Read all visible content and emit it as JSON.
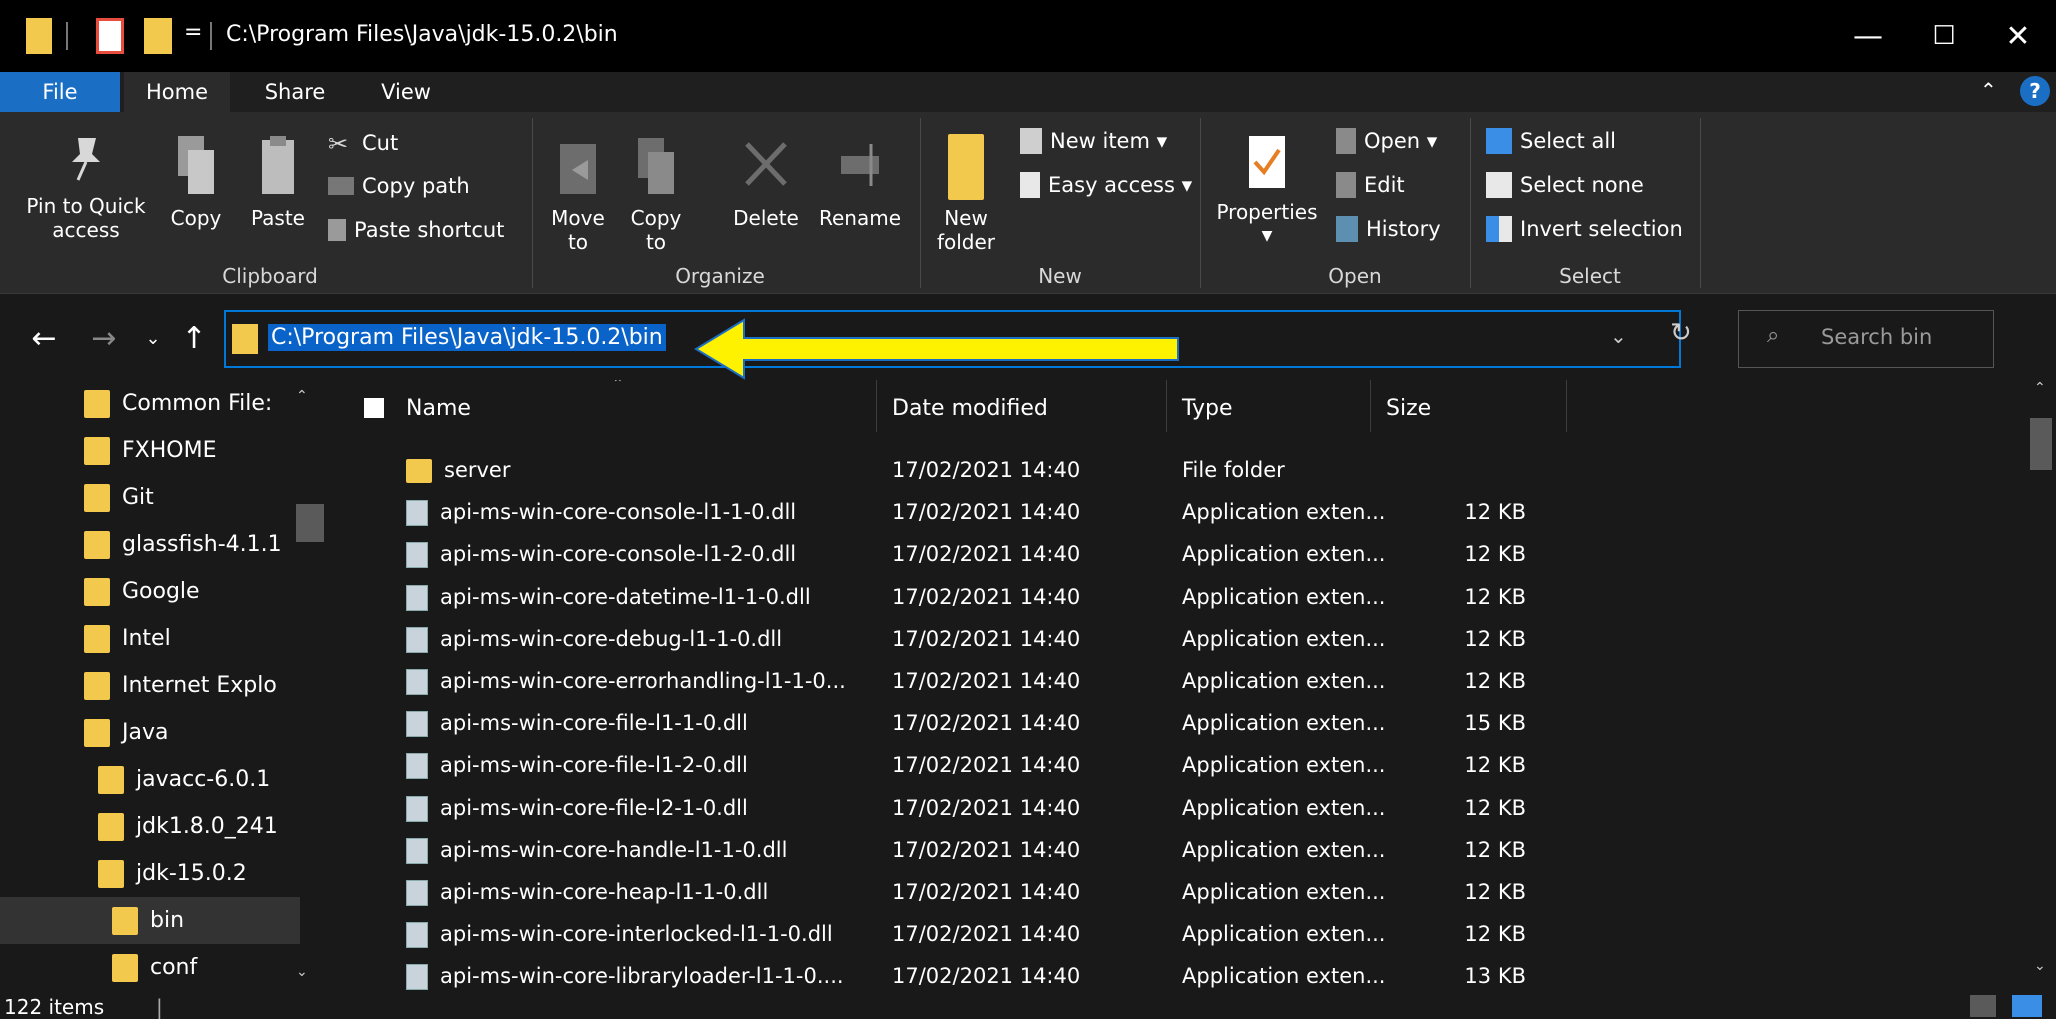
{
  "window": {
    "title": "C:\\Program Files\\Java\\jdk-15.0.2\\bin",
    "qat_dropdown": "=",
    "minimize": "—",
    "maximize": "☐",
    "close": "✕"
  },
  "tabs": [
    "File",
    "Home",
    "Share",
    "View"
  ],
  "ribbon": {
    "clipboard": {
      "pin": "Pin to Quick access",
      "copy": "Copy",
      "paste": "Paste",
      "cut": "Cut",
      "copy_path": "Copy path",
      "paste_shortcut": "Paste shortcut",
      "label": "Clipboard"
    },
    "organize": {
      "move_to": "Move to",
      "copy_to": "Copy to",
      "delete": "Delete",
      "rename": "Rename",
      "label": "Organize"
    },
    "new": {
      "new_folder": "New folder",
      "new_item": "New item ▾",
      "easy_access": "Easy access ▾",
      "label": "New"
    },
    "open": {
      "properties": "Properties",
      "open": "Open ▾",
      "edit": "Edit",
      "history": "History",
      "label": "Open"
    },
    "select": {
      "select_all": "Select all",
      "select_none": "Select none",
      "invert": "Invert selection",
      "label": "Select"
    }
  },
  "address": {
    "path": "C:\\Program Files\\Java\\jdk-15.0.2\\bin",
    "search_placeholder": "Search bin"
  },
  "nav_pane": [
    {
      "label": "Common File:",
      "indent": 1
    },
    {
      "label": "FXHOME",
      "indent": 1
    },
    {
      "label": "Git",
      "indent": 1
    },
    {
      "label": "glassfish-4.1.1",
      "indent": 1
    },
    {
      "label": "Google",
      "indent": 1
    },
    {
      "label": "Intel",
      "indent": 1
    },
    {
      "label": "Internet Explo",
      "indent": 1
    },
    {
      "label": "Java",
      "indent": 1
    },
    {
      "label": "javacc-6.0.1",
      "indent": 2
    },
    {
      "label": "jdk1.8.0_241",
      "indent": 2
    },
    {
      "label": "jdk-15.0.2",
      "indent": 2
    },
    {
      "label": "bin",
      "indent": 3,
      "selected": true
    },
    {
      "label": "conf",
      "indent": 3
    }
  ],
  "columns": {
    "name": "Name",
    "date": "Date modified",
    "type": "Type",
    "size": "Size"
  },
  "files": [
    {
      "name": "server",
      "date": "17/02/2021 14:40",
      "type": "File folder",
      "size": "",
      "folder": true
    },
    {
      "name": "api-ms-win-core-console-l1-1-0.dll",
      "date": "17/02/2021 14:40",
      "type": "Application exten...",
      "size": "12 KB"
    },
    {
      "name": "api-ms-win-core-console-l1-2-0.dll",
      "date": "17/02/2021 14:40",
      "type": "Application exten...",
      "size": "12 KB"
    },
    {
      "name": "api-ms-win-core-datetime-l1-1-0.dll",
      "date": "17/02/2021 14:40",
      "type": "Application exten...",
      "size": "12 KB"
    },
    {
      "name": "api-ms-win-core-debug-l1-1-0.dll",
      "date": "17/02/2021 14:40",
      "type": "Application exten...",
      "size": "12 KB"
    },
    {
      "name": "api-ms-win-core-errorhandling-l1-1-0...",
      "date": "17/02/2021 14:40",
      "type": "Application exten...",
      "size": "12 KB"
    },
    {
      "name": "api-ms-win-core-file-l1-1-0.dll",
      "date": "17/02/2021 14:40",
      "type": "Application exten...",
      "size": "15 KB"
    },
    {
      "name": "api-ms-win-core-file-l1-2-0.dll",
      "date": "17/02/2021 14:40",
      "type": "Application exten...",
      "size": "12 KB"
    },
    {
      "name": "api-ms-win-core-file-l2-1-0.dll",
      "date": "17/02/2021 14:40",
      "type": "Application exten...",
      "size": "12 KB"
    },
    {
      "name": "api-ms-win-core-handle-l1-1-0.dll",
      "date": "17/02/2021 14:40",
      "type": "Application exten...",
      "size": "12 KB"
    },
    {
      "name": "api-ms-win-core-heap-l1-1-0.dll",
      "date": "17/02/2021 14:40",
      "type": "Application exten...",
      "size": "12 KB"
    },
    {
      "name": "api-ms-win-core-interlocked-l1-1-0.dll",
      "date": "17/02/2021 14:40",
      "type": "Application exten...",
      "size": "12 KB"
    },
    {
      "name": "api-ms-win-core-libraryloader-l1-1-0....",
      "date": "17/02/2021 14:40",
      "type": "Application exten...",
      "size": "13 KB"
    }
  ],
  "status": {
    "items": "122 items"
  },
  "colors": {
    "accent": "#0078d7",
    "arrow_fill": "#fff200",
    "folder": "#f2c94c"
  }
}
